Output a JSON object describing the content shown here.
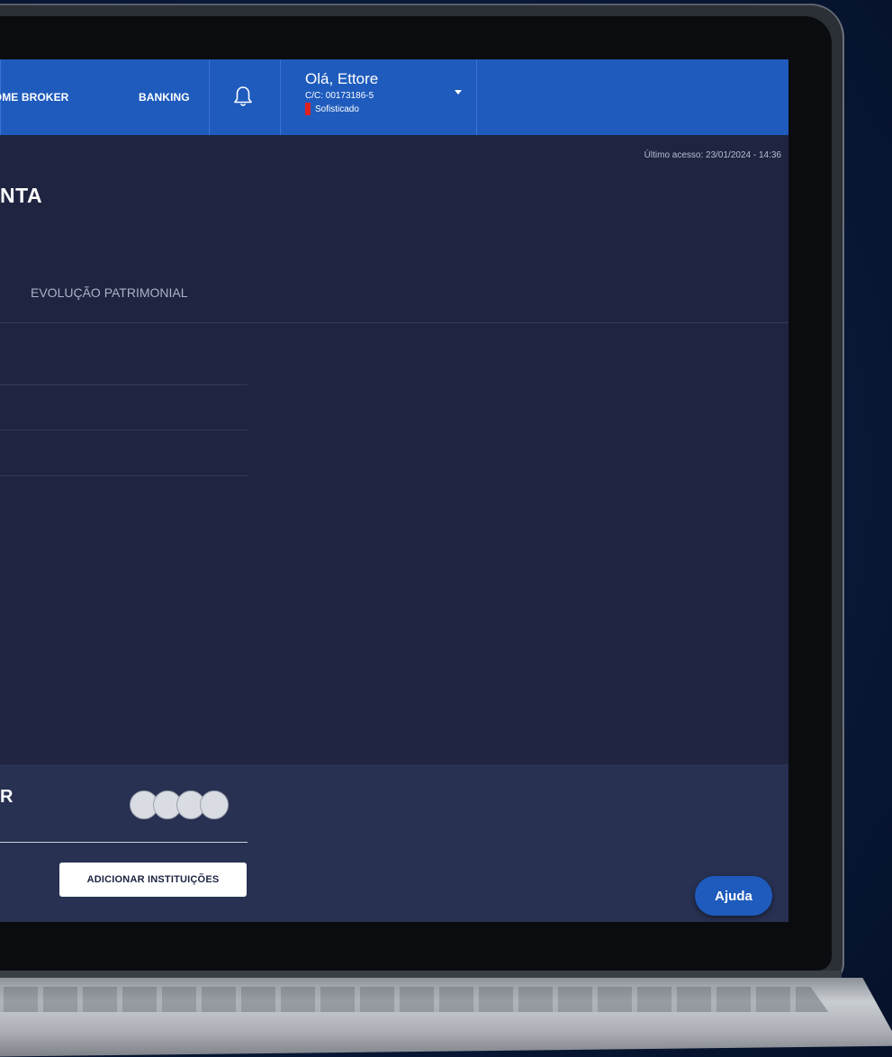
{
  "header": {
    "nav_home_broker": "HOME BROKER",
    "nav_banking": "BANKING",
    "user": {
      "greeting": "Olá, Ettore",
      "account": "C/C: 00173186-5",
      "profile": "Sofisticado"
    }
  },
  "main": {
    "last_access": "Último acesso: 23/01/2024 - 14:36",
    "title": "NTA",
    "tab_label": "EVOLUÇÃO PATRIMONIAL"
  },
  "panel": {
    "letter": "R",
    "add_button": "ADICIONAR INSTITUIÇÕES"
  },
  "help_button": "Ajuda",
  "icons": {
    "bell": "bell-icon",
    "caret": "chevron-down-icon",
    "logos": "institution-logo-icon"
  },
  "colors": {
    "header_blue": "#1e5bbd",
    "screen_bg": "#1f2440",
    "panel_bg": "#283152",
    "profile_flag": "#e02020"
  }
}
